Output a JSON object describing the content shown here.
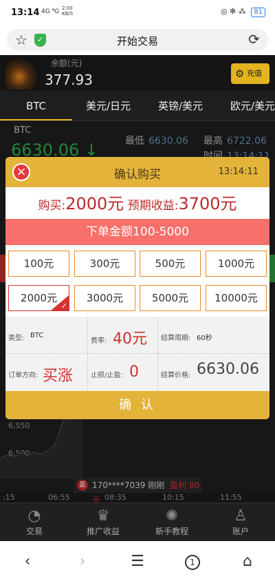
{
  "status": {
    "time": "13:14",
    "signals": "4G  ⁴G",
    "speed_value": "2.00",
    "speed_unit": "KB/S",
    "right_icons": "◎ ✻ ⁂",
    "battery": "81"
  },
  "browser": {
    "title": "开始交易",
    "star_icon": "☆",
    "reload_icon": "⟳"
  },
  "account": {
    "balance_label": "余额(元)",
    "balance_value": "377.93",
    "recharge_label": "充值"
  },
  "tabs": [
    "BTC",
    "美元/日元",
    "英镑/美元",
    "欧元/美元"
  ],
  "market": {
    "symbol": "BTC",
    "price": "6630.06 ↓",
    "low_label": "最低",
    "low_value": "6630.06",
    "high_label": "最高",
    "high_value": "6722.06",
    "time_label": "时间",
    "time_value": "13:14:11",
    "ytick_1": "6,550",
    "ytick_2": "6,500",
    "xticks": [
      ":15",
      "06:55",
      "08:35",
      "10:15",
      "11:55"
    ]
  },
  "ticker": {
    "badge": "赢",
    "user": "170****7039 刚刚",
    "profit": "盈利 80元"
  },
  "modal": {
    "title": "确认购买",
    "time": "13:14:11",
    "buy_label": "购买:",
    "buy_amount": "2000元",
    "expected_label": "预期收益:",
    "expected_amount": "3700元",
    "range_text": "下单金额100-5000",
    "amounts": [
      "100元",
      "300元",
      "500元",
      "1000元",
      "2000元",
      "3000元",
      "5000元",
      "10000元"
    ],
    "selected_index": 4,
    "type_label": "类型:",
    "type_value": "BTC",
    "fee_label": "费率:",
    "fee_value": "40元",
    "period_label": "结算周期:",
    "period_value": "60秒",
    "direction_label": "订单方向:",
    "direction_value": "买涨",
    "stop_label": "止损/止盈:",
    "stop_value": "0",
    "settle_label": "结算价格:",
    "settle_value": "6630.06",
    "confirm_label": "确 认"
  },
  "bottomnav": [
    "交易",
    "推广收益",
    "新手教程",
    "账户"
  ],
  "colors": {
    "accent": "#e4b33a",
    "red": "#d23030",
    "green": "#2fb34a",
    "banner": "#f7706b"
  }
}
